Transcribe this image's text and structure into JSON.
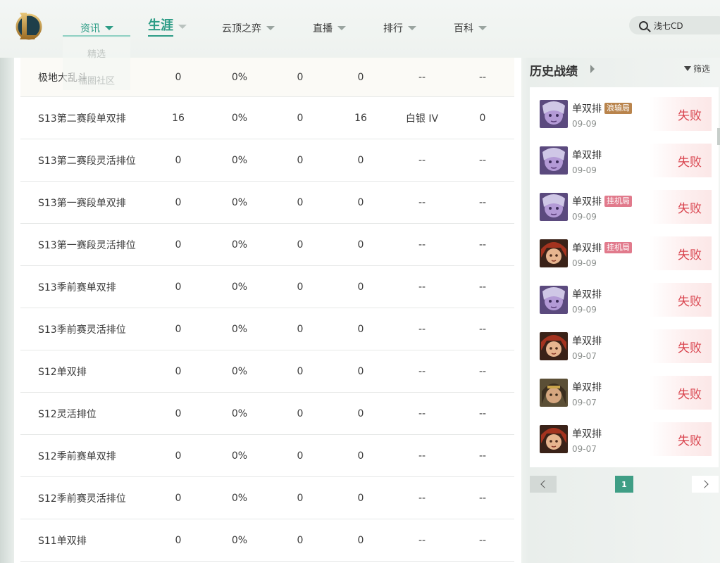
{
  "nav": {
    "items": [
      {
        "label": "资讯"
      },
      {
        "label": "生涯"
      },
      {
        "label": "云顶之弈"
      },
      {
        "label": "直播"
      },
      {
        "label": "排行"
      },
      {
        "label": "百科"
      }
    ],
    "dropdown": [
      "精选",
      "福圈社区"
    ],
    "search_value": "浅七CD"
  },
  "table": {
    "rows": [
      {
        "name": "极地大乱斗",
        "cols": [
          "0",
          "0%",
          "0",
          "0",
          "--",
          "--"
        ]
      },
      {
        "name": "S13第二赛段单双排",
        "cols": [
          "16",
          "0%",
          "0",
          "16",
          "白银 IV",
          "0"
        ]
      },
      {
        "name": "S13第二赛段灵活排位",
        "cols": [
          "0",
          "0%",
          "0",
          "0",
          "--",
          "--"
        ]
      },
      {
        "name": "S13第一赛段单双排",
        "cols": [
          "0",
          "0%",
          "0",
          "0",
          "--",
          "--"
        ]
      },
      {
        "name": "S13第一赛段灵活排位",
        "cols": [
          "0",
          "0%",
          "0",
          "0",
          "--",
          "--"
        ]
      },
      {
        "name": "S13季前赛单双排",
        "cols": [
          "0",
          "0%",
          "0",
          "0",
          "--",
          "--"
        ]
      },
      {
        "name": "S13季前赛灵活排位",
        "cols": [
          "0",
          "0%",
          "0",
          "0",
          "--",
          "--"
        ]
      },
      {
        "name": "S12单双排",
        "cols": [
          "0",
          "0%",
          "0",
          "0",
          "--",
          "--"
        ]
      },
      {
        "name": "S12灵活排位",
        "cols": [
          "0",
          "0%",
          "0",
          "0",
          "--",
          "--"
        ]
      },
      {
        "name": "S12季前赛单双排",
        "cols": [
          "0",
          "0%",
          "0",
          "0",
          "--",
          "--"
        ]
      },
      {
        "name": "S12季前赛灵活排位",
        "cols": [
          "0",
          "0%",
          "0",
          "0",
          "--",
          "--"
        ]
      },
      {
        "name": "S11单双排",
        "cols": [
          "0",
          "0%",
          "0",
          "0",
          "--",
          "--"
        ]
      }
    ]
  },
  "history": {
    "title": "历史战绩",
    "filter_label": "筛选",
    "matches": [
      {
        "queue": "单双排",
        "tag": "浪输局",
        "tag_color": "#b9844c",
        "date": "09-09",
        "result": "失败",
        "champ": "purple"
      },
      {
        "queue": "单双排",
        "tag": "",
        "tag_color": "",
        "date": "09-09",
        "result": "失败",
        "champ": "purple"
      },
      {
        "queue": "单双排",
        "tag": "挂机局",
        "tag_color": "#e17a8c",
        "date": "09-09",
        "result": "失败",
        "champ": "purple"
      },
      {
        "queue": "单双排",
        "tag": "挂机局",
        "tag_color": "#e17a8c",
        "date": "09-09",
        "result": "失败",
        "champ": "red"
      },
      {
        "queue": "单双排",
        "tag": "",
        "tag_color": "",
        "date": "09-09",
        "result": "失败",
        "champ": "purple"
      },
      {
        "queue": "单双排",
        "tag": "",
        "tag_color": "",
        "date": "09-07",
        "result": "失败",
        "champ": "red"
      },
      {
        "queue": "单双排",
        "tag": "",
        "tag_color": "",
        "date": "09-07",
        "result": "失败",
        "champ": "olive"
      },
      {
        "queue": "单双排",
        "tag": "",
        "tag_color": "",
        "date": "09-07",
        "result": "失败",
        "champ": "red"
      }
    ],
    "page": "1"
  },
  "colors": {
    "accent": "#2d9c86",
    "loss": "#d9454f",
    "page_active": "#3f9e85"
  }
}
